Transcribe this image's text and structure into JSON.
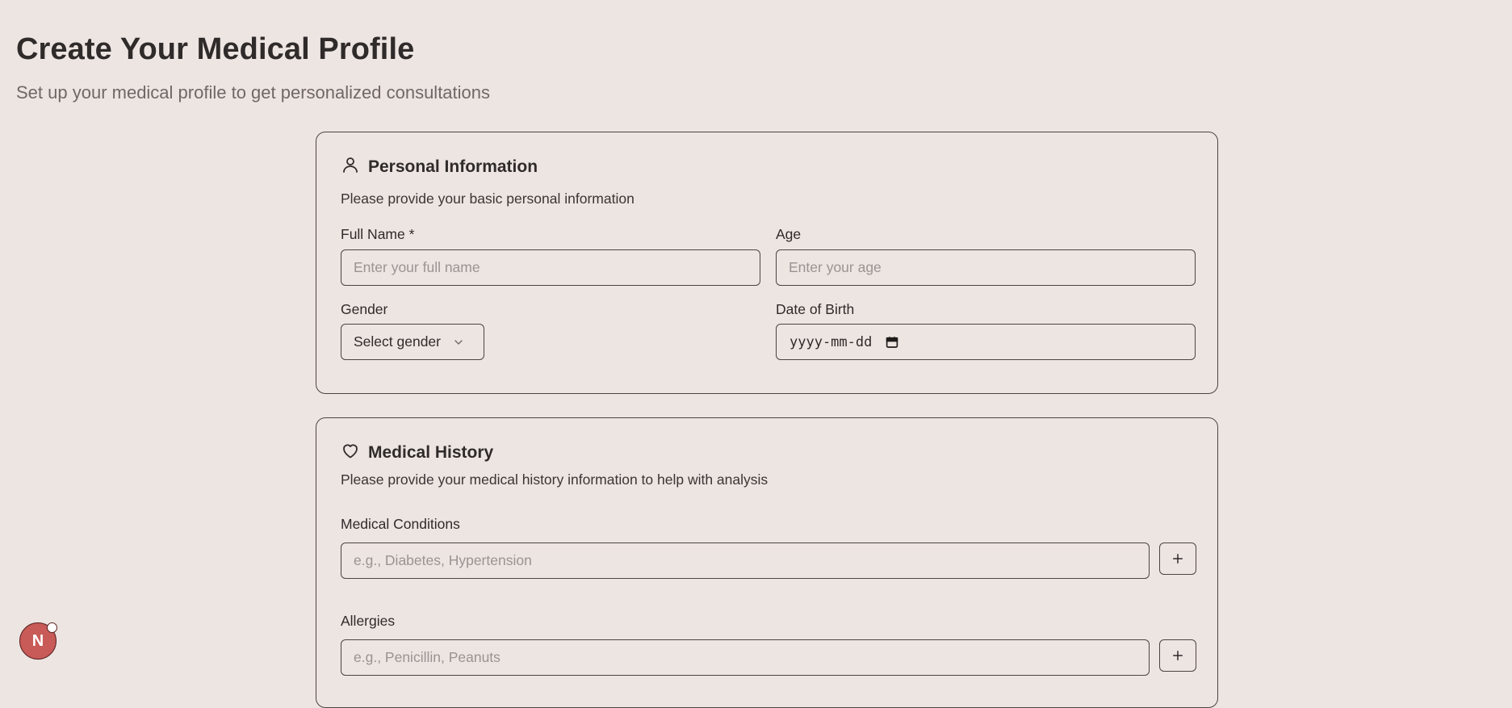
{
  "page": {
    "title": "Create Your Medical Profile",
    "subtitle": "Set up your medical profile to get personalized consultations"
  },
  "personal": {
    "title": "Personal Information",
    "icon": "user-icon",
    "description": "Please provide your basic personal information",
    "full_name_label": "Full Name *",
    "full_name_placeholder": "Enter your full name",
    "full_name_value": "",
    "age_label": "Age",
    "age_placeholder": "Enter your age",
    "age_value": "",
    "gender_label": "Gender",
    "gender_value": "Select gender",
    "dob_label": "Date of Birth",
    "dob_value": "yyyy-mm-dd"
  },
  "medical": {
    "title": "Medical History",
    "icon": "heart-icon",
    "description": "Please provide your medical history information to help with analysis",
    "conditions_label": "Medical Conditions",
    "conditions_placeholder": "e.g., Diabetes, Hypertension",
    "allergies_label": "Allergies",
    "allergies_placeholder": "e.g., Penicillin, Peanuts",
    "add_label": "+"
  },
  "fab": {
    "letter": "N"
  },
  "colors": {
    "background": "#ede5e2",
    "border": "#4a4443",
    "fab": "#c85a57"
  }
}
